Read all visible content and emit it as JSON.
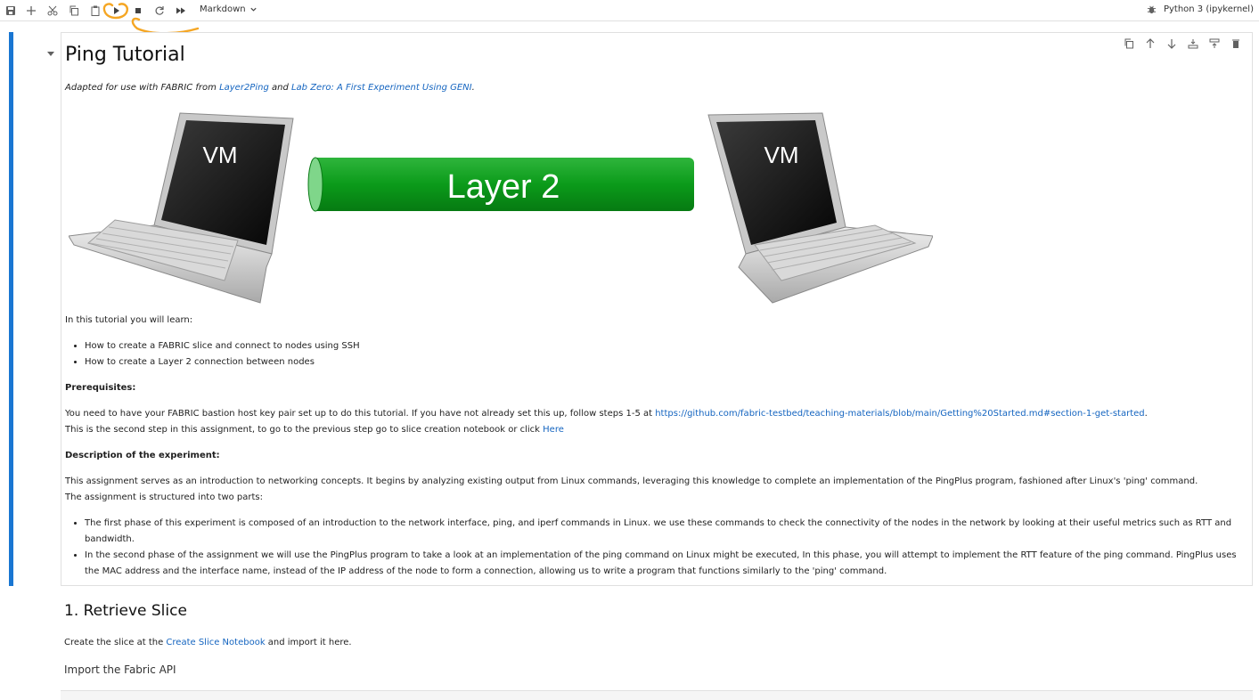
{
  "toolbar": {
    "buttons": [
      "save-icon",
      "add-cell-icon",
      "cut-icon",
      "copy-icon",
      "paste-icon",
      "run-icon",
      "stop-icon",
      "restart-icon",
      "run-all-icon"
    ],
    "cell_type": "Markdown",
    "kernel_name": "Python 3 (ipykernel)",
    "annotation_color": "#f5a623"
  },
  "cell": {
    "title": "Ping Tutorial",
    "subtitle": {
      "prefix": "Adapted for use with FABRIC from ",
      "link1": "Layer2Ping",
      "mid": " and ",
      "link2": "Lab Zero: A First Experiment Using GENI",
      "suffix": "."
    },
    "diagram": {
      "left_label": "VM",
      "right_label": "VM",
      "link_label": "Layer 2",
      "link_color": "#0b9b1a"
    },
    "intro": "In this tutorial you will learn:",
    "learn_items": [
      "How to create a FABRIC slice and connect to nodes using SSH",
      "How to create a Layer 2 connection between nodes"
    ],
    "prereq_heading": "Prerequisites:",
    "prereq_text": "You need to have your FABRIC bastion host key pair set up to do this tutorial. If you have not already set this up, follow steps 1-5 at ",
    "prereq_link": "https://github.com/fabric-testbed/teaching-materials/blob/main/Getting%20Started.md#section-1-get-started",
    "prereq_end": ".",
    "second_step_text": "This is the second step in this assignment, to go to the previous step go to slice creation notebook or click ",
    "second_step_link": "Here",
    "desc_heading": "Description of the experiment:",
    "desc_text1": "This assignment serves as an introduction to networking concepts. It begins by analyzing existing output from Linux commands, leveraging this knowledge to complete an implementation of the PingPlus program, fashioned after Linux's 'ping' command.",
    "desc_text2": "The assignment is structured into two parts:",
    "phases": [
      "The first phase of this experiment is composed of an introduction to the network interface, ping, and iperf commands in Linux. we use these commands to check the connectivity of the nodes in the network by looking at their useful metrics such as RTT and bandwidth.",
      "In the second phase of the assignment we will use the PingPlus program to take a look at an implementation of the ping command on Linux might be executed, In this phase, you will attempt to implement the RTT feature of the ping command. PingPlus uses the MAC address and the interface name, instead of the IP address of the node to form a connection, allowing us to write a program that functions similarly to the 'ping' command."
    ]
  },
  "section": {
    "heading": "1. Retrieve Slice",
    "text_prefix": "Create the slice at the ",
    "link": "Create Slice Notebook",
    "text_suffix": " and import it here.",
    "subheading": "Import the Fabric API"
  }
}
